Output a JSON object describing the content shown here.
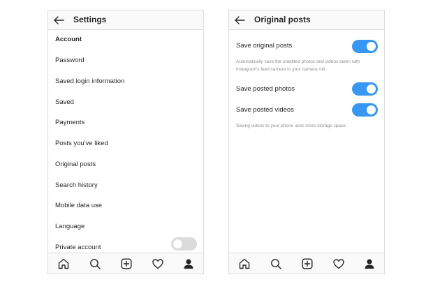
{
  "left_screen": {
    "title": "Settings",
    "section_heading": "Account",
    "items": [
      {
        "label": "Password"
      },
      {
        "label": "Saved login information"
      },
      {
        "label": "Saved"
      },
      {
        "label": "Payments"
      },
      {
        "label": "Posts you've liked"
      },
      {
        "label": "Original posts"
      },
      {
        "label": "Search history"
      },
      {
        "label": "Mobile data use"
      },
      {
        "label": "Language"
      },
      {
        "label": "Private account"
      }
    ],
    "private_account_toggle": "off"
  },
  "right_screen": {
    "title": "Original posts",
    "settings": [
      {
        "label": "Save original posts",
        "state": "on"
      },
      {
        "label": "Save posted photos",
        "state": "on"
      },
      {
        "label": "Save posted videos",
        "state": "on"
      }
    ],
    "save_original_description": "Automatically save the unedited photos and videos taken with Instagram's feed camera to your camera roll.",
    "videos_description": "Saving videos to your phone uses more storage space."
  },
  "tabbar": {
    "icons": [
      "home-icon",
      "search-icon",
      "add-post-icon",
      "heart-icon",
      "profile-icon"
    ]
  },
  "colors": {
    "toggle_on": "#3897f0",
    "toggle_off": "#dbdbdb",
    "border": "#dbdbdb",
    "text": "#262626",
    "muted_text": "#8e8e8e"
  }
}
